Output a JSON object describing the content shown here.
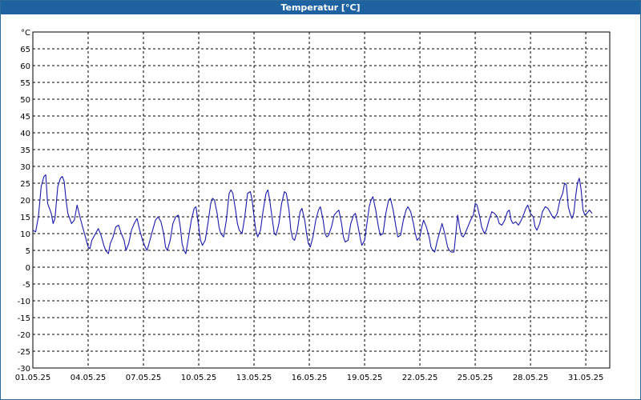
{
  "window": {
    "title": "Temperatur [°C]"
  },
  "chart_data": {
    "type": "line",
    "title": "Temperatur [°C]",
    "y_unit": "°C",
    "ylim": [
      -30,
      70
    ],
    "y_ticks": [
      65,
      60,
      55,
      50,
      45,
      40,
      35,
      30,
      25,
      20,
      15,
      10,
      5,
      0,
      -5,
      -10,
      -15,
      -20,
      -25,
      -30
    ],
    "x_ticks": [
      "01.05.25",
      "04.05.25",
      "07.05.25",
      "10.05.25",
      "13.05.25",
      "16.05.25",
      "19.05.25",
      "22.05.25",
      "25.05.25",
      "28.05.25",
      "31.05.25"
    ],
    "x_range_days": [
      0,
      31.3
    ],
    "grid": true,
    "line_color": "#1a1aa8",
    "series": [
      {
        "points": [
          [
            0.0,
            11
          ],
          [
            0.15,
            10.5
          ],
          [
            0.3,
            15
          ],
          [
            0.45,
            24
          ],
          [
            0.6,
            27
          ],
          [
            0.7,
            27.5
          ],
          [
            0.8,
            19
          ],
          [
            0.9,
            17.5
          ],
          [
            1.0,
            16
          ],
          [
            1.1,
            13
          ],
          [
            1.2,
            14.5
          ],
          [
            1.35,
            24
          ],
          [
            1.5,
            26.5
          ],
          [
            1.6,
            27
          ],
          [
            1.7,
            25.5
          ],
          [
            1.8,
            20
          ],
          [
            1.9,
            16
          ],
          [
            2.0,
            14.5
          ],
          [
            2.1,
            13
          ],
          [
            2.25,
            14
          ],
          [
            2.4,
            18.5
          ],
          [
            2.55,
            15
          ],
          [
            2.7,
            12
          ],
          [
            2.85,
            9
          ],
          [
            3.0,
            6
          ],
          [
            3.1,
            5.5
          ],
          [
            3.2,
            8
          ],
          [
            3.4,
            10
          ],
          [
            3.55,
            11.5
          ],
          [
            3.7,
            9.5
          ],
          [
            3.85,
            6.5
          ],
          [
            3.95,
            5
          ],
          [
            4.1,
            4
          ],
          [
            4.2,
            7
          ],
          [
            4.35,
            9
          ],
          [
            4.5,
            12
          ],
          [
            4.65,
            12.5
          ],
          [
            4.8,
            10
          ],
          [
            4.95,
            8
          ],
          [
            5.05,
            5
          ],
          [
            5.2,
            7
          ],
          [
            5.35,
            11
          ],
          [
            5.5,
            13
          ],
          [
            5.65,
            14.5
          ],
          [
            5.8,
            11
          ],
          [
            5.95,
            8
          ],
          [
            6.1,
            6
          ],
          [
            6.2,
            5
          ],
          [
            6.35,
            8
          ],
          [
            6.5,
            11
          ],
          [
            6.65,
            14
          ],
          [
            6.8,
            15
          ],
          [
            6.95,
            13.5
          ],
          [
            7.1,
            10
          ],
          [
            7.2,
            6
          ],
          [
            7.3,
            5
          ],
          [
            7.45,
            8
          ],
          [
            7.6,
            13
          ],
          [
            7.75,
            15
          ],
          [
            7.9,
            15.5
          ],
          [
            8.0,
            12
          ],
          [
            8.1,
            7
          ],
          [
            8.2,
            5
          ],
          [
            8.3,
            4
          ],
          [
            8.45,
            9
          ],
          [
            8.6,
            14
          ],
          [
            8.75,
            17.5
          ],
          [
            8.85,
            18
          ],
          [
            9.0,
            12
          ],
          [
            9.1,
            8
          ],
          [
            9.2,
            6.5
          ],
          [
            9.35,
            8
          ],
          [
            9.5,
            13
          ],
          [
            9.65,
            19
          ],
          [
            9.75,
            20.5
          ],
          [
            9.85,
            20
          ],
          [
            10.0,
            16
          ],
          [
            10.1,
            12
          ],
          [
            10.2,
            10
          ],
          [
            10.35,
            9
          ],
          [
            10.5,
            14
          ],
          [
            10.65,
            22
          ],
          [
            10.75,
            23
          ],
          [
            10.85,
            22
          ],
          [
            11.0,
            17
          ],
          [
            11.1,
            13
          ],
          [
            11.2,
            11
          ],
          [
            11.35,
            10
          ],
          [
            11.5,
            15
          ],
          [
            11.65,
            22
          ],
          [
            11.8,
            22.5
          ],
          [
            11.9,
            20
          ],
          [
            12.0,
            15
          ],
          [
            12.1,
            11
          ],
          [
            12.2,
            9
          ],
          [
            12.35,
            11
          ],
          [
            12.5,
            17
          ],
          [
            12.65,
            22
          ],
          [
            12.75,
            23
          ],
          [
            12.85,
            20
          ],
          [
            13.0,
            14
          ],
          [
            13.1,
            10
          ],
          [
            13.2,
            9.5
          ],
          [
            13.35,
            13
          ],
          [
            13.5,
            19
          ],
          [
            13.65,
            22.5
          ],
          [
            13.75,
            22
          ],
          [
            13.9,
            17
          ],
          [
            14.0,
            11
          ],
          [
            14.1,
            8.5
          ],
          [
            14.2,
            8
          ],
          [
            14.35,
            11
          ],
          [
            14.5,
            16.5
          ],
          [
            14.6,
            17.5
          ],
          [
            14.75,
            14
          ],
          [
            14.85,
            10
          ],
          [
            14.95,
            7
          ],
          [
            15.05,
            6
          ],
          [
            15.2,
            9
          ],
          [
            15.35,
            14
          ],
          [
            15.5,
            17
          ],
          [
            15.6,
            18
          ],
          [
            15.75,
            14
          ],
          [
            15.85,
            10
          ],
          [
            15.95,
            9
          ],
          [
            16.05,
            9.5
          ],
          [
            16.2,
            12
          ],
          [
            16.35,
            15.5
          ],
          [
            16.5,
            16.5
          ],
          [
            16.6,
            17
          ],
          [
            16.75,
            13
          ],
          [
            16.85,
            9
          ],
          [
            16.95,
            7.5
          ],
          [
            17.1,
            8
          ],
          [
            17.25,
            13
          ],
          [
            17.4,
            15.5
          ],
          [
            17.5,
            16
          ],
          [
            17.65,
            12
          ],
          [
            17.75,
            9
          ],
          [
            17.85,
            6.5
          ],
          [
            18.0,
            8
          ],
          [
            18.1,
            12
          ],
          [
            18.25,
            18
          ],
          [
            18.35,
            20
          ],
          [
            18.45,
            21
          ],
          [
            18.6,
            17
          ],
          [
            18.75,
            12
          ],
          [
            18.85,
            9.5
          ],
          [
            19.0,
            10
          ],
          [
            19.15,
            16
          ],
          [
            19.3,
            20
          ],
          [
            19.4,
            20.5
          ],
          [
            19.55,
            17
          ],
          [
            19.7,
            12
          ],
          [
            19.8,
            9
          ],
          [
            19.95,
            9.5
          ],
          [
            20.1,
            14
          ],
          [
            20.25,
            17
          ],
          [
            20.35,
            18
          ],
          [
            20.5,
            16.5
          ],
          [
            20.65,
            13
          ],
          [
            20.75,
            10
          ],
          [
            20.85,
            8
          ],
          [
            21.0,
            9
          ],
          [
            21.1,
            12
          ],
          [
            21.2,
            14
          ],
          [
            21.35,
            12
          ],
          [
            21.5,
            9
          ],
          [
            21.6,
            6
          ],
          [
            21.7,
            5
          ],
          [
            21.8,
            4.5
          ],
          [
            21.95,
            8
          ],
          [
            22.1,
            11
          ],
          [
            22.2,
            13
          ],
          [
            22.35,
            10
          ],
          [
            22.5,
            6
          ],
          [
            22.6,
            5
          ],
          [
            22.7,
            4.5
          ],
          [
            22.85,
            4.5
          ],
          [
            22.95,
            10
          ],
          [
            23.05,
            15.5
          ],
          [
            23.15,
            12
          ],
          [
            23.25,
            9.5
          ],
          [
            23.35,
            9
          ],
          [
            23.45,
            10
          ],
          [
            23.6,
            12
          ],
          [
            23.75,
            14
          ],
          [
            23.9,
            15.5
          ],
          [
            24.0,
            19
          ],
          [
            24.1,
            18.5
          ],
          [
            24.25,
            15
          ],
          [
            24.35,
            12
          ],
          [
            24.5,
            10
          ],
          [
            24.6,
            11
          ],
          [
            24.75,
            14
          ],
          [
            24.9,
            16.5
          ],
          [
            25.05,
            16
          ],
          [
            25.2,
            15
          ],
          [
            25.3,
            13
          ],
          [
            25.45,
            12.5
          ],
          [
            25.6,
            14
          ],
          [
            25.75,
            16.5
          ],
          [
            25.85,
            17
          ],
          [
            25.95,
            14
          ],
          [
            26.05,
            13
          ],
          [
            26.2,
            13.5
          ],
          [
            26.35,
            12.5
          ],
          [
            26.5,
            14
          ],
          [
            26.65,
            16
          ],
          [
            26.75,
            17.5
          ],
          [
            26.85,
            18.5
          ],
          [
            27.0,
            16
          ],
          [
            27.15,
            15
          ],
          [
            27.25,
            12
          ],
          [
            27.35,
            11
          ],
          [
            27.5,
            13
          ],
          [
            27.65,
            16.5
          ],
          [
            27.8,
            18
          ],
          [
            27.95,
            17.5
          ],
          [
            28.1,
            16
          ],
          [
            28.2,
            15
          ],
          [
            28.3,
            14.5
          ],
          [
            28.45,
            16
          ],
          [
            28.6,
            20
          ],
          [
            28.75,
            22
          ],
          [
            28.85,
            25
          ],
          [
            28.95,
            24.5
          ],
          [
            29.05,
            18
          ],
          [
            29.15,
            16
          ],
          [
            29.25,
            14.5
          ],
          [
            29.35,
            16
          ],
          [
            29.45,
            21
          ],
          [
            29.55,
            25
          ],
          [
            29.65,
            26.5
          ],
          [
            29.75,
            23
          ],
          [
            29.85,
            17
          ],
          [
            29.95,
            15.5
          ],
          [
            30.05,
            16
          ],
          [
            30.2,
            17
          ],
          [
            30.35,
            16
          ]
        ]
      }
    ]
  }
}
